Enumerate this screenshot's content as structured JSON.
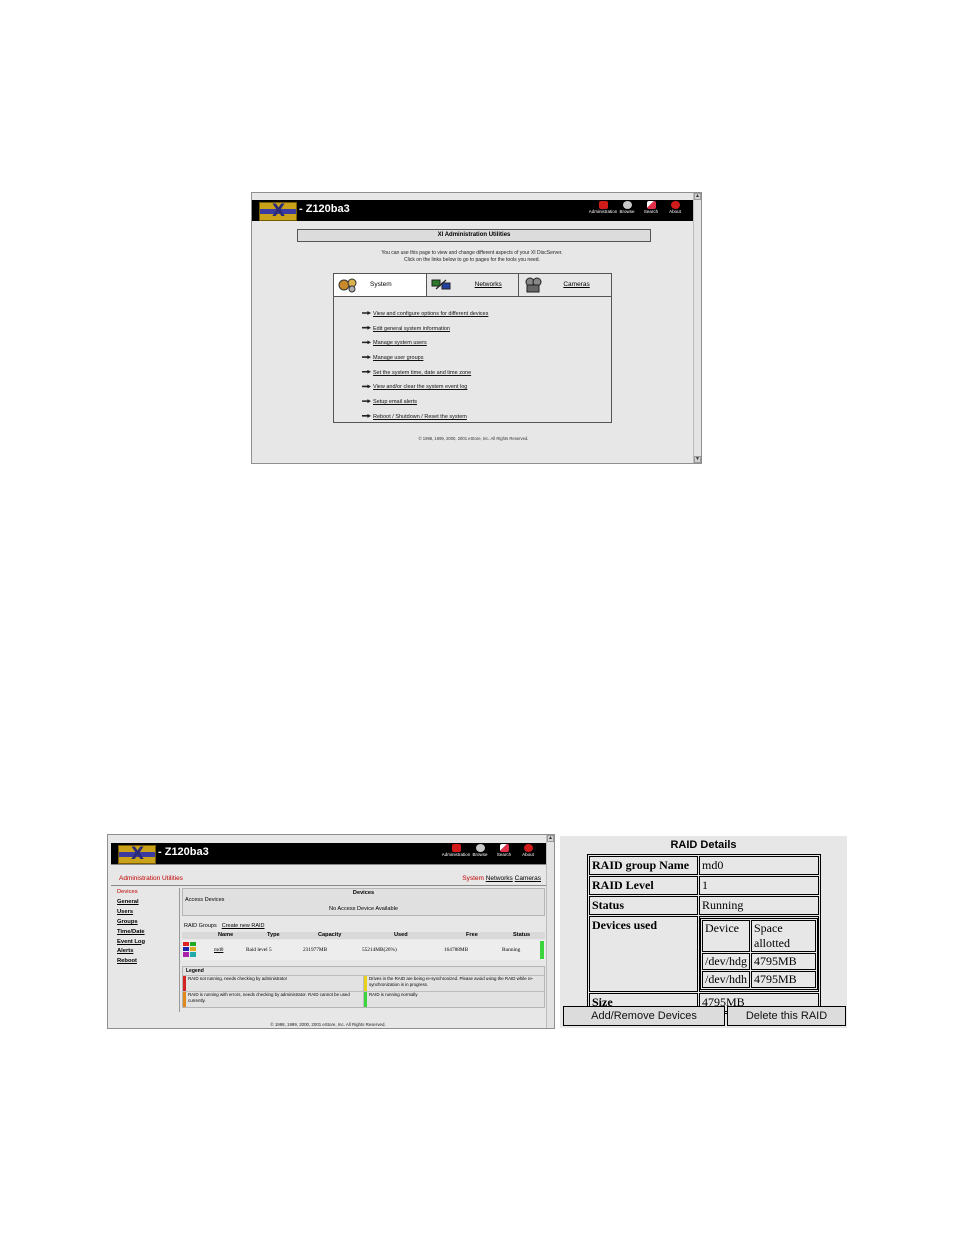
{
  "window1": {
    "app_title": "- Z120ba3",
    "top_icons": [
      {
        "label": "Administration",
        "icon": "administration-icon",
        "color": "#d11b1b"
      },
      {
        "label": "Browse",
        "icon": "browse-icon",
        "color": "#c9c9c9"
      },
      {
        "label": "Search",
        "icon": "search-icon",
        "color": "#e0304a"
      },
      {
        "label": "About",
        "icon": "about-icon",
        "color": "#d11b1b"
      }
    ],
    "heading": "XI Administration Utilities",
    "intro_line1": "You can use this page to view and change different aspects of your XI DiscServer.",
    "intro_line2": "Click on the links below to go to pages for the tools you need.",
    "tabs": [
      "System",
      "Networks",
      "Cameras"
    ],
    "links": [
      "View and configure options for different devices",
      "Edit general system information",
      "Manage system users",
      "Manage user groups",
      "Set the system time, date and time zone",
      "View and/or clear the system event log",
      "Setup email alerts",
      "Reboot / Shutdown / Reset the system"
    ],
    "copyright": "© 1998, 1999, 2000, 2001 eStore, Inc. All Rights Reserved."
  },
  "window2": {
    "app_title": "- Z120ba3",
    "section_title": "Administration Utilities",
    "tabs": {
      "system": "System",
      "networks": "Networks",
      "cameras": "Cameras"
    },
    "sidebar": [
      "Devices",
      "General",
      "Users",
      "Groups",
      "Time/Date",
      "Event Log",
      "Alerts",
      "Reboot"
    ],
    "devices_title": "Devices",
    "access_devices_label": "Access Devices",
    "no_access_devices": "No Access Device Available",
    "raid_groups_label": "RAID Groups",
    "create_raid_link": "Create new RAID",
    "columns": [
      "Name",
      "Type",
      "Capacity",
      "Used",
      "Free",
      "Status"
    ],
    "raid_row": {
      "name": "md0",
      "type": "Raid level 5",
      "capacity": "231977MB",
      "used": "55214MB(26%)",
      "free": "164788MB",
      "status": "Running"
    },
    "legend_title": "Legend",
    "legend": [
      {
        "text": "RAID not running, needs checking by administrator",
        "color": "#d22222"
      },
      {
        "text": "Drives in the RAID are being re-synchronized. Please avoid using the RAID while re-synchronization is in progress.",
        "color": "#e8d11a"
      },
      {
        "text": "RAID is running with errors, needs checking by administrator. RAID cannot be used currently.",
        "color": "#e08a1c"
      },
      {
        "text": "RAID is running normally",
        "color": "#3cd43c"
      }
    ],
    "copyright": "© 1998, 1999, 2000, 2001 eStore, Inc. All Rights Reserved."
  },
  "raid_details": {
    "title": "RAID Details",
    "group_name_label": "RAID group Name",
    "group_name": "md0",
    "level_label": "RAID Level",
    "level": "1",
    "status_label": "Status",
    "status": "Running",
    "devices_used_label": "Devices used",
    "device_col": "Device",
    "space_col": "Space allotted",
    "devices": [
      {
        "device": "/dev/hdg",
        "space": "4795MB"
      },
      {
        "device": "/dev/hdh",
        "space": "4795MB"
      }
    ],
    "size_label": "Size",
    "size": "4795MB",
    "add_remove_button": "Add/Remove Devices",
    "delete_button": "Delete this RAID"
  }
}
